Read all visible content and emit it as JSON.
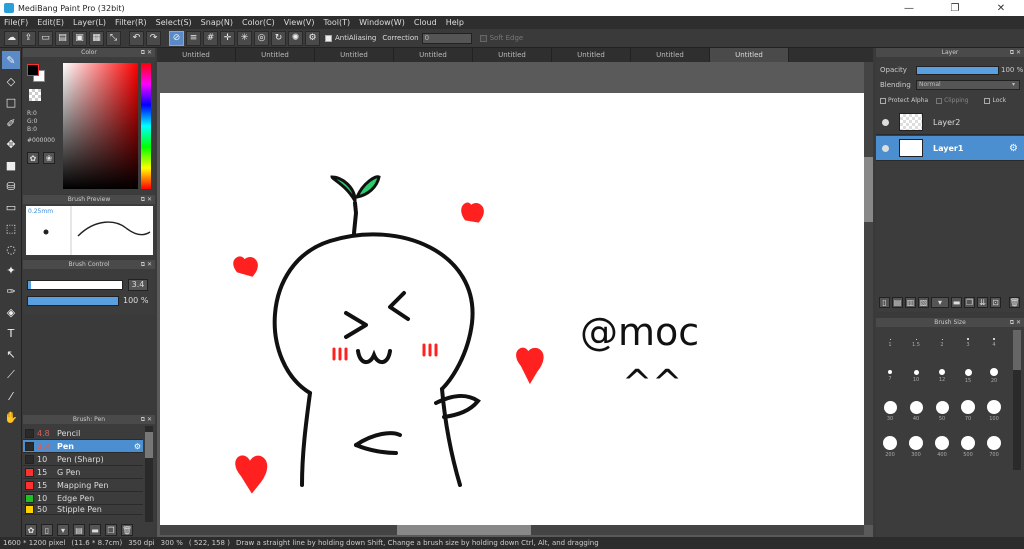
{
  "window": {
    "title": "MediBang Paint Pro (32bit)"
  },
  "menu": [
    "File(F)",
    "Edit(E)",
    "Layer(L)",
    "Filter(R)",
    "Select(S)",
    "Snap(N)",
    "Color(C)",
    "View(V)",
    "Tool(T)",
    "Window(W)",
    "Cloud",
    "Help"
  ],
  "toolbar": {
    "antialias_label": "AntiAliasing",
    "correction_label": "Correction",
    "correction_value": "0",
    "soft_edge_label": "Soft Edge"
  },
  "tabs": [
    "Untitled",
    "Untitled",
    "Untitled",
    "Untitled",
    "Untitled",
    "Untitled",
    "Untitled",
    "Untitled"
  ],
  "color_panel": {
    "title": "Color",
    "r": "R:0",
    "g": "G:0",
    "b": "B:0",
    "hex": "#000000",
    "fg_color": "#000000"
  },
  "brush_preview": {
    "title": "Brush Preview",
    "size": "0.25mm"
  },
  "brush_control": {
    "title": "Brush Control",
    "size_value": "3.4",
    "opacity_value": "100 %",
    "size_fraction": 0.03,
    "opacity_fraction": 1.0
  },
  "brush_list": {
    "title": "Brush: Pen",
    "items": [
      {
        "size": "4.8",
        "name": "Pencil",
        "color": "#2a2a2a"
      },
      {
        "size": "3.4",
        "name": "Pen",
        "color": "#2a2a2a"
      },
      {
        "size": "10",
        "name": "Pen (Sharp)",
        "color": "#2a2a2a"
      },
      {
        "size": "15",
        "name": "G Pen",
        "color": "#ff3030"
      },
      {
        "size": "15",
        "name": "Mapping Pen",
        "color": "#ff3030"
      },
      {
        "size": "10",
        "name": "Edge Pen",
        "color": "#20c020"
      },
      {
        "size": "50",
        "name": "Stipple Pen",
        "color": "#ffd000"
      }
    ]
  },
  "layer_panel": {
    "title": "Layer",
    "opacity_label": "Opacity",
    "opacity_value": "100 %",
    "blending_label": "Blending",
    "blending_value": "Normal",
    "protect_alpha": "Protect Alpha",
    "clipping": "Clipping",
    "lock": "Lock",
    "layers": [
      {
        "name": "Layer2"
      },
      {
        "name": "Layer1"
      }
    ]
  },
  "brush_size_panel": {
    "title": "Brush Size",
    "sizes": [
      "1",
      "1.5",
      "2",
      "3",
      "4",
      "7",
      "10",
      "12",
      "15",
      "20",
      "30",
      "40",
      "50",
      "70",
      "100",
      "200",
      "300",
      "400",
      "500",
      "700"
    ]
  },
  "canvas": {
    "signature": "@moc",
    "emote": "^^"
  },
  "status": {
    "dimensions": "1600 * 1200 pixel",
    "physical": "(11.6 * 8.7cm)",
    "dpi": "350 dpi",
    "zoom": "300 %",
    "coords": "( 522, 158 )",
    "hint": "Draw a straight line by holding down Shift, Change a brush size by holding down Ctrl, Alt, and dragging"
  },
  "colors": {
    "accent": "#4b8fd0",
    "panel_bg": "#3c3c3c",
    "canvas_bg": "#ffffff",
    "ink_red": "#ff2020",
    "sprout_green": "#2ecc71"
  }
}
